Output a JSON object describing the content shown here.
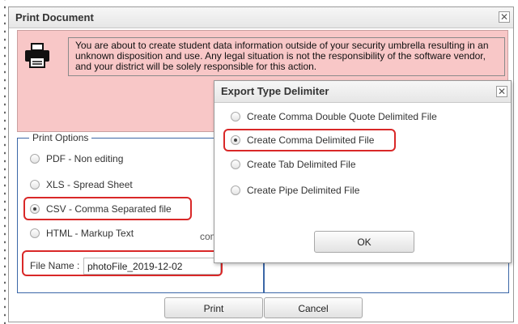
{
  "print_dialog": {
    "title": "Print Document",
    "close_glyph": "✕",
    "warning_text": "You are about to create student data information outside of your security umbrella resulting in an unknown disposition and use. Any legal situation is not the responsibility of the software vendor, and your district will be solely responsible for this action.",
    "print_options_legend": "Print Options",
    "options": [
      {
        "label": "PDF - Non editing",
        "selected": false
      },
      {
        "label": "XLS - Spread Sheet",
        "selected": false
      },
      {
        "label": "CSV - Comma Separated file",
        "selected": true
      },
      {
        "label": "HTML - Markup Text",
        "selected": false
      }
    ],
    "partial_text": "com",
    "file_name_label": "File Name :",
    "file_name_value": "photoFile_2019-12-02",
    "print_button": "Print",
    "cancel_button": "Cancel"
  },
  "delimiter_dialog": {
    "title": "Export Type Delimiter",
    "close_glyph": "✕",
    "options": [
      {
        "label": "Create Comma Double Quote Delimited File",
        "selected": false
      },
      {
        "label": "Create Comma Delimited File",
        "selected": true
      },
      {
        "label": "Create Tab Delimited File",
        "selected": false
      },
      {
        "label": "Create Pipe Delimited File",
        "selected": false
      }
    ],
    "ok_button": "OK"
  },
  "colors": {
    "warning_background": "#f8c7c7",
    "highlight_outline": "#d92828",
    "fieldset_border": "#3b67a7"
  },
  "icons": {
    "printer": "printer-icon",
    "close": "close-icon"
  }
}
